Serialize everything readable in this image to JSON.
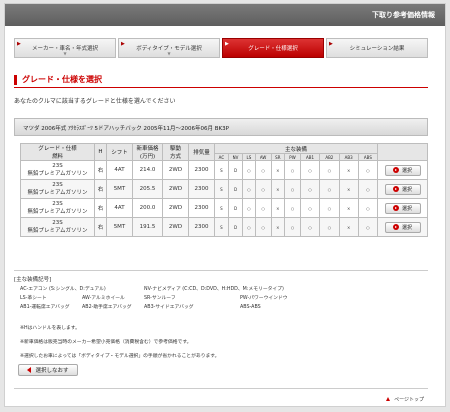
{
  "header": {
    "title": "下取り参考価格情報"
  },
  "steps": [
    {
      "label": "メーカー・車名・年式選択",
      "active": false
    },
    {
      "label": "ボディタイプ・モデル選択",
      "active": false
    },
    {
      "label": "グレード・仕様選択",
      "active": true
    },
    {
      "label": "シミュレーション結果",
      "active": false
    }
  ],
  "section": {
    "title": "グレード・仕様を選択",
    "intro": "あなたのクルマに該当するグレードと仕様を選んでください"
  },
  "car": {
    "info": "マツダ 2006年式 ｱｸｾﾗｽﾎﾟｰﾂ 5ドアハッチバック 2005年11月〜2006年06月 BK3P"
  },
  "table": {
    "headers": {
      "grade": "グレード・仕様",
      "fuel": "燃料",
      "h": "H",
      "shift": "シフト",
      "price": "新車価格",
      "price_unit": "(万円)",
      "drive": "駆動",
      "drive2": "方式",
      "displacement": "排気量",
      "equipment": "主な装備",
      "equip_cols": [
        "AC",
        "NV",
        "LS",
        "AW",
        "SR",
        "PW",
        "AB1",
        "AB2",
        "AB3",
        "ABS"
      ]
    },
    "rows": [
      {
        "grade": "23S",
        "fuel": "無鉛プレミアムガソリン",
        "h": "右",
        "shift": "4AT",
        "price": "214.0",
        "drive": "2WD",
        "displacement": "2300",
        "equip": [
          "S",
          "D",
          "○",
          "○",
          "×",
          "○",
          "○",
          "○",
          "×",
          "○"
        ],
        "button": "選択"
      },
      {
        "grade": "23S",
        "fuel": "無鉛プレミアムガソリン",
        "h": "右",
        "shift": "5MT",
        "price": "205.5",
        "drive": "2WD",
        "displacement": "2300",
        "equip": [
          "S",
          "D",
          "○",
          "○",
          "×",
          "○",
          "○",
          "○",
          "×",
          "○"
        ],
        "button": "選択"
      },
      {
        "grade": "23S",
        "fuel": "無鉛プレミアムガソリン",
        "h": "右",
        "shift": "4AT",
        "price": "200.0",
        "drive": "2WD",
        "displacement": "2300",
        "equip": [
          "S",
          "D",
          "○",
          "○",
          "×",
          "○",
          "○",
          "○",
          "×",
          "○"
        ],
        "button": "選択"
      },
      {
        "grade": "23S",
        "fuel": "無鉛プレミアムガソリン",
        "h": "右",
        "shift": "5MT",
        "price": "191.5",
        "drive": "2WD",
        "displacement": "2300",
        "equip": [
          "S",
          "D",
          "○",
          "○",
          "×",
          "○",
          "○",
          "○",
          "×",
          "○"
        ],
        "button": "選択"
      }
    ]
  },
  "legend": {
    "title": "[主な装備記号]",
    "rows": [
      [
        "AC-エアコン (S:シングル、D:デュアル)",
        "NV-ナビメディア (C:CD、D:DVD、H:HDD、M:メモリータイプ)"
      ],
      [
        "LS-革シート",
        "AW-アルミホイール",
        "SR-サンルーフ",
        "PW-パワーウインドウ"
      ],
      [
        "AB1-運転席エアバッグ",
        "AB2-助手席エアバッグ",
        "AB3-サイドエアバッグ",
        "ABS-ABS"
      ]
    ]
  },
  "notes": [
    "※Hはハンドルを表します。",
    "※新車価格は販売当時のメーカー希望小売価格（消費税含む）で参考価格です。",
    "※選択したお車によっては「ボディタイプ・モデル選択」の手順が省かれることがあります。"
  ],
  "back_button": "選択しなおす",
  "page_top": "ページトップ"
}
